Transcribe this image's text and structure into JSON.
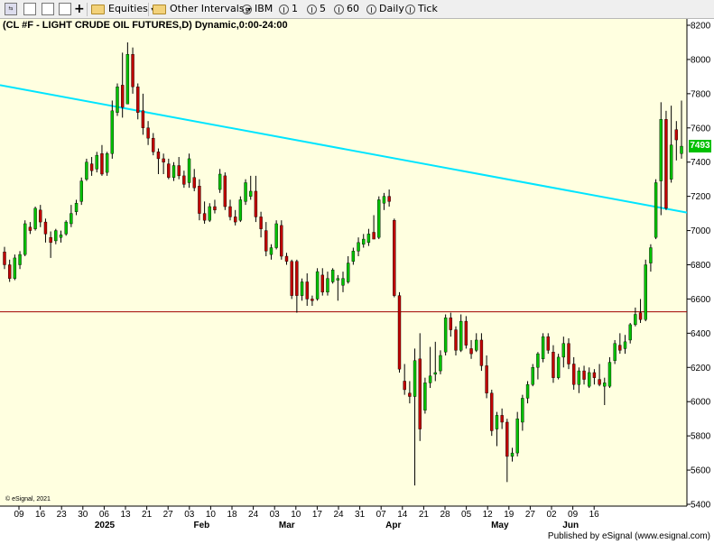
{
  "toolbar": {
    "items": [
      {
        "name": "equities",
        "label": "Equities"
      },
      {
        "name": "other-intervals",
        "label": "Other Intervals"
      },
      {
        "name": "ibm",
        "label": "IBM"
      },
      {
        "name": "interval-1",
        "label": "1"
      },
      {
        "name": "interval-5",
        "label": "5"
      },
      {
        "name": "interval-60",
        "label": "60"
      },
      {
        "name": "daily",
        "label": "Daily"
      },
      {
        "name": "tick",
        "label": "Tick"
      }
    ],
    "dropdown_glyph": "▾"
  },
  "chart_title": "(CL #F - LIGHT CRUDE OIL FUTURES,D) Dynamic,0:00-24:00",
  "credit": "© eSignal, 2021",
  "published": "Published by eSignal (www.esignal.com)",
  "last_price_label": "7493",
  "colors": {
    "background": "#ffffe0",
    "up": "#00c000",
    "down": "#c00000",
    "trendline": "#00e5ff",
    "support": "#a00000"
  },
  "chart_data": {
    "type": "candlestick",
    "title": "(CL #F - LIGHT CRUDE OIL FUTURES,D) Dynamic,0:00-24:00",
    "ylim": [
      5400,
      8200
    ],
    "y_ticks": [
      "8200",
      "8000",
      "7800",
      "7600",
      "7400",
      "7200",
      "7000",
      "6800",
      "6600",
      "6400",
      "6200",
      "6000",
      "5800",
      "5600",
      "5400"
    ],
    "x_ticks": [
      "09",
      "16",
      "23",
      "30",
      "06",
      "13",
      "21",
      "27",
      "03",
      "10",
      "18",
      "24",
      "03",
      "10",
      "17",
      "24",
      "31",
      "07",
      "14",
      "21",
      "28",
      "05",
      "12",
      "19",
      "27",
      "02",
      "09",
      "16"
    ],
    "months": [
      "2025",
      "Feb",
      "Mar",
      "Apr",
      "May",
      "Jun"
    ],
    "trendline": {
      "start_value": 7850,
      "end_value": 7105
    },
    "support_level": 6525,
    "last_price": 7493,
    "candles": [
      {
        "o": 6875,
        "h": 6905,
        "l": 6775,
        "c": 6800
      },
      {
        "o": 6800,
        "h": 6830,
        "l": 6700,
        "c": 6720
      },
      {
        "o": 6720,
        "h": 6860,
        "l": 6710,
        "c": 6840
      },
      {
        "o": 6800,
        "h": 6880,
        "l": 6775,
        "c": 6860
      },
      {
        "o": 6860,
        "h": 7060,
        "l": 6850,
        "c": 7040
      },
      {
        "o": 7020,
        "h": 7050,
        "l": 6980,
        "c": 7000
      },
      {
        "o": 7010,
        "h": 7140,
        "l": 7000,
        "c": 7130
      },
      {
        "o": 7120,
        "h": 7150,
        "l": 7020,
        "c": 7050
      },
      {
        "o": 7050,
        "h": 7070,
        "l": 6930,
        "c": 6980
      },
      {
        "o": 6960,
        "h": 6995,
        "l": 6840,
        "c": 6930
      },
      {
        "o": 6940,
        "h": 7010,
        "l": 6920,
        "c": 7000
      },
      {
        "o": 6960,
        "h": 7000,
        "l": 6930,
        "c": 6975
      },
      {
        "o": 6980,
        "h": 7060,
        "l": 6970,
        "c": 7050
      },
      {
        "o": 7040,
        "h": 7150,
        "l": 7020,
        "c": 7100
      },
      {
        "o": 7110,
        "h": 7180,
        "l": 7090,
        "c": 7160
      },
      {
        "o": 7170,
        "h": 7310,
        "l": 7150,
        "c": 7290
      },
      {
        "o": 7300,
        "h": 7420,
        "l": 7290,
        "c": 7400
      },
      {
        "o": 7390,
        "h": 7430,
        "l": 7320,
        "c": 7350
      },
      {
        "o": 7360,
        "h": 7460,
        "l": 7340,
        "c": 7440
      },
      {
        "o": 7450,
        "h": 7500,
        "l": 7320,
        "c": 7330
      },
      {
        "o": 7340,
        "h": 7460,
        "l": 7320,
        "c": 7450
      },
      {
        "o": 7450,
        "h": 7760,
        "l": 7420,
        "c": 7700
      },
      {
        "o": 7690,
        "h": 7860,
        "l": 7670,
        "c": 7840
      },
      {
        "o": 7850,
        "h": 8040,
        "l": 7660,
        "c": 7720
      },
      {
        "o": 7740,
        "h": 8100,
        "l": 7740,
        "c": 8030
      },
      {
        "o": 8030,
        "h": 8070,
        "l": 7800,
        "c": 7840
      },
      {
        "o": 7840,
        "h": 7860,
        "l": 7650,
        "c": 7690
      },
      {
        "o": 7700,
        "h": 7800,
        "l": 7560,
        "c": 7600
      },
      {
        "o": 7600,
        "h": 7640,
        "l": 7500,
        "c": 7540
      },
      {
        "o": 7540,
        "h": 7570,
        "l": 7440,
        "c": 7460
      },
      {
        "o": 7460,
        "h": 7480,
        "l": 7330,
        "c": 7420
      },
      {
        "o": 7420,
        "h": 7450,
        "l": 7330,
        "c": 7400
      },
      {
        "o": 7390,
        "h": 7420,
        "l": 7300,
        "c": 7310
      },
      {
        "o": 7310,
        "h": 7400,
        "l": 7290,
        "c": 7380
      },
      {
        "o": 7380,
        "h": 7430,
        "l": 7300,
        "c": 7320
      },
      {
        "o": 7320,
        "h": 7350,
        "l": 7250,
        "c": 7270
      },
      {
        "o": 7280,
        "h": 7450,
        "l": 7250,
        "c": 7420
      },
      {
        "o": 7310,
        "h": 7360,
        "l": 7230,
        "c": 7250
      },
      {
        "o": 7260,
        "h": 7300,
        "l": 7060,
        "c": 7100
      },
      {
        "o": 7100,
        "h": 7170,
        "l": 7040,
        "c": 7060
      },
      {
        "o": 7060,
        "h": 7160,
        "l": 7050,
        "c": 7140
      },
      {
        "o": 7140,
        "h": 7180,
        "l": 7100,
        "c": 7120
      },
      {
        "o": 7240,
        "h": 7360,
        "l": 7220,
        "c": 7330
      },
      {
        "o": 7320,
        "h": 7340,
        "l": 7120,
        "c": 7140
      },
      {
        "o": 7140,
        "h": 7180,
        "l": 7060,
        "c": 7080
      },
      {
        "o": 7080,
        "h": 7120,
        "l": 7030,
        "c": 7050
      },
      {
        "o": 7060,
        "h": 7200,
        "l": 7050,
        "c": 7180
      },
      {
        "o": 7170,
        "h": 7300,
        "l": 7150,
        "c": 7280
      },
      {
        "o": 7200,
        "h": 7320,
        "l": 7180,
        "c": 7230
      },
      {
        "o": 7230,
        "h": 7320,
        "l": 7050,
        "c": 7080
      },
      {
        "o": 7080,
        "h": 7110,
        "l": 6960,
        "c": 7010
      },
      {
        "o": 7000,
        "h": 7050,
        "l": 6850,
        "c": 6880
      },
      {
        "o": 6860,
        "h": 6920,
        "l": 6830,
        "c": 6900
      },
      {
        "o": 6900,
        "h": 7060,
        "l": 6890,
        "c": 7040
      },
      {
        "o": 7030,
        "h": 7060,
        "l": 6830,
        "c": 6850
      },
      {
        "o": 6850,
        "h": 6870,
        "l": 6800,
        "c": 6820
      },
      {
        "o": 6820,
        "h": 6830,
        "l": 6600,
        "c": 6620
      },
      {
        "o": 6820,
        "h": 6830,
        "l": 6520,
        "c": 6620
      },
      {
        "o": 6620,
        "h": 6720,
        "l": 6590,
        "c": 6700
      },
      {
        "o": 6700,
        "h": 6750,
        "l": 6560,
        "c": 6600
      },
      {
        "o": 6600,
        "h": 6620,
        "l": 6560,
        "c": 6590
      },
      {
        "o": 6600,
        "h": 6780,
        "l": 6590,
        "c": 6760
      },
      {
        "o": 6740,
        "h": 6780,
        "l": 6620,
        "c": 6640
      },
      {
        "o": 6640,
        "h": 6760,
        "l": 6620,
        "c": 6720
      },
      {
        "o": 6700,
        "h": 6780,
        "l": 6690,
        "c": 6770
      },
      {
        "o": 6710,
        "h": 6740,
        "l": 6590,
        "c": 6720
      },
      {
        "o": 6680,
        "h": 6760,
        "l": 6640,
        "c": 6720
      },
      {
        "o": 6700,
        "h": 6850,
        "l": 6690,
        "c": 6810
      },
      {
        "o": 6820,
        "h": 6900,
        "l": 6800,
        "c": 6880
      },
      {
        "o": 6880,
        "h": 6960,
        "l": 6850,
        "c": 6930
      },
      {
        "o": 6920,
        "h": 6980,
        "l": 6900,
        "c": 6950
      },
      {
        "o": 6930,
        "h": 7010,
        "l": 6910,
        "c": 6980
      },
      {
        "o": 6990,
        "h": 7090,
        "l": 6970,
        "c": 6950
      },
      {
        "o": 6960,
        "h": 7200,
        "l": 6950,
        "c": 7180
      },
      {
        "o": 7160,
        "h": 7220,
        "l": 7120,
        "c": 7200
      },
      {
        "o": 7200,
        "h": 7240,
        "l": 7140,
        "c": 7170
      },
      {
        "o": 7060,
        "h": 7070,
        "l": 6610,
        "c": 6620
      },
      {
        "o": 6620,
        "h": 6640,
        "l": 6170,
        "c": 6190
      },
      {
        "o": 6120,
        "h": 6220,
        "l": 6040,
        "c": 6070
      },
      {
        "o": 6050,
        "h": 6120,
        "l": 5990,
        "c": 6030
      },
      {
        "o": 6030,
        "h": 6310,
        "l": 5510,
        "c": 6240
      },
      {
        "o": 6250,
        "h": 6400,
        "l": 5770,
        "c": 5840
      },
      {
        "o": 5950,
        "h": 6140,
        "l": 5930,
        "c": 6110
      },
      {
        "o": 6110,
        "h": 6320,
        "l": 6080,
        "c": 6150
      },
      {
        "o": 6160,
        "h": 6350,
        "l": 6120,
        "c": 6170
      },
      {
        "o": 6180,
        "h": 6300,
        "l": 6160,
        "c": 6270
      },
      {
        "o": 6290,
        "h": 6510,
        "l": 6270,
        "c": 6490
      },
      {
        "o": 6490,
        "h": 6520,
        "l": 6380,
        "c": 6420
      },
      {
        "o": 6420,
        "h": 6440,
        "l": 6270,
        "c": 6300
      },
      {
        "o": 6300,
        "h": 6510,
        "l": 6290,
        "c": 6470
      },
      {
        "o": 6470,
        "h": 6500,
        "l": 6310,
        "c": 6330
      },
      {
        "o": 6310,
        "h": 6360,
        "l": 6250,
        "c": 6280
      },
      {
        "o": 6300,
        "h": 6400,
        "l": 6290,
        "c": 6360
      },
      {
        "o": 6360,
        "h": 6400,
        "l": 6180,
        "c": 6210
      },
      {
        "o": 6210,
        "h": 6270,
        "l": 6020,
        "c": 6050
      },
      {
        "o": 6050,
        "h": 6070,
        "l": 5800,
        "c": 5830
      },
      {
        "o": 5840,
        "h": 5940,
        "l": 5740,
        "c": 5920
      },
      {
        "o": 5920,
        "h": 5960,
        "l": 5840,
        "c": 5880
      },
      {
        "o": 5880,
        "h": 5900,
        "l": 5530,
        "c": 5680
      },
      {
        "o": 5680,
        "h": 5730,
        "l": 5650,
        "c": 5700
      },
      {
        "o": 5700,
        "h": 5940,
        "l": 5680,
        "c": 5900
      },
      {
        "o": 5880,
        "h": 6040,
        "l": 5830,
        "c": 6020
      },
      {
        "o": 6020,
        "h": 6120,
        "l": 5990,
        "c": 6100
      },
      {
        "o": 6100,
        "h": 6220,
        "l": 6090,
        "c": 6200
      },
      {
        "o": 6200,
        "h": 6290,
        "l": 6130,
        "c": 6280
      },
      {
        "o": 6250,
        "h": 6400,
        "l": 6230,
        "c": 6380
      },
      {
        "o": 6380,
        "h": 6400,
        "l": 6280,
        "c": 6300
      },
      {
        "o": 6290,
        "h": 6330,
        "l": 6110,
        "c": 6140
      },
      {
        "o": 6140,
        "h": 6280,
        "l": 6130,
        "c": 6260
      },
      {
        "o": 6260,
        "h": 6380,
        "l": 6200,
        "c": 6340
      },
      {
        "o": 6340,
        "h": 6370,
        "l": 6190,
        "c": 6220
      },
      {
        "o": 6220,
        "h": 6260,
        "l": 6070,
        "c": 6100
      },
      {
        "o": 6100,
        "h": 6200,
        "l": 6050,
        "c": 6180
      },
      {
        "o": 6180,
        "h": 6210,
        "l": 6100,
        "c": 6130
      },
      {
        "o": 6090,
        "h": 6200,
        "l": 6080,
        "c": 6170
      },
      {
        "o": 6170,
        "h": 6190,
        "l": 6100,
        "c": 6140
      },
      {
        "o": 6130,
        "h": 6220,
        "l": 6090,
        "c": 6100
      },
      {
        "o": 6090,
        "h": 6140,
        "l": 5980,
        "c": 6110
      },
      {
        "o": 6090,
        "h": 6260,
        "l": 6080,
        "c": 6230
      },
      {
        "o": 6240,
        "h": 6360,
        "l": 6220,
        "c": 6340
      },
      {
        "o": 6330,
        "h": 6400,
        "l": 6280,
        "c": 6300
      },
      {
        "o": 6310,
        "h": 6390,
        "l": 6280,
        "c": 6350
      },
      {
        "o": 6360,
        "h": 6460,
        "l": 6340,
        "c": 6450
      },
      {
        "o": 6450,
        "h": 6550,
        "l": 6440,
        "c": 6510
      },
      {
        "o": 6520,
        "h": 6600,
        "l": 6460,
        "c": 6480
      },
      {
        "o": 6480,
        "h": 6830,
        "l": 6470,
        "c": 6800
      },
      {
        "o": 6810,
        "h": 6920,
        "l": 6760,
        "c": 6900
      },
      {
        "o": 6960,
        "h": 7300,
        "l": 6950,
        "c": 7280
      },
      {
        "o": 7290,
        "h": 7750,
        "l": 7090,
        "c": 7650
      },
      {
        "o": 7650,
        "h": 7700,
        "l": 7120,
        "c": 7130
      },
      {
        "o": 7300,
        "h": 7730,
        "l": 7280,
        "c": 7500
      },
      {
        "o": 7590,
        "h": 7640,
        "l": 7410,
        "c": 7530
      },
      {
        "o": 7450,
        "h": 7760,
        "l": 7420,
        "c": 7493
      }
    ]
  }
}
